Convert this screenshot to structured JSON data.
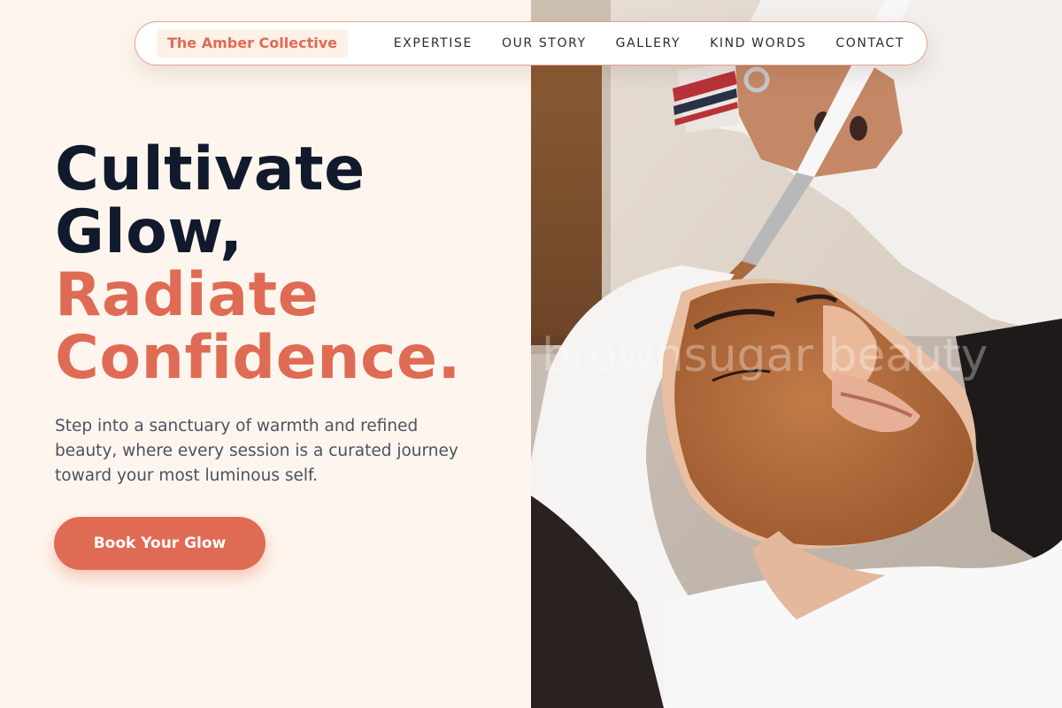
{
  "nav": {
    "brand": "The Amber Collective",
    "links": [
      "EXPERTISE",
      "OUR STORY",
      "GALLERY",
      "KIND WORDS",
      "CONTACT"
    ]
  },
  "hero": {
    "headline_dark_1": "Cultivate",
    "headline_dark_2": "Glow,",
    "headline_accent_1": "Radiate",
    "headline_accent_2": "Confidence.",
    "subtext": "Step into a sanctuary of warmth and refined beauty, where every session is a curated journey toward your most luminous self.",
    "cta_label": "Book Your Glow"
  },
  "image": {
    "watermark": "brownsugar beauty",
    "description_icon": "facial-mask-photo"
  },
  "colors": {
    "accent": "#e06b54",
    "dark": "#111a2c",
    "background": "#fef6ee",
    "body_text": "#4b5160"
  }
}
